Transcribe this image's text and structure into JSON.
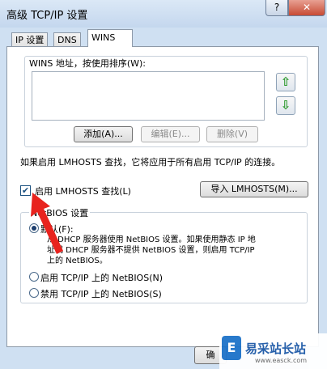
{
  "window": {
    "title": "高级 TCP/IP 设置",
    "help_label": "?",
    "close_label": "✕"
  },
  "tabs": [
    {
      "label": "IP 设置",
      "active": false
    },
    {
      "label": "DNS",
      "active": false
    },
    {
      "label": "WINS",
      "active": true
    }
  ],
  "wins": {
    "group_label": "WINS 地址，按使用排序(W):",
    "addresses": [],
    "up_icon": "green-up-arrow-icon",
    "down_icon": "green-down-arrow-icon",
    "add_label": "添加(A)...",
    "edit_label": "编辑(E)...",
    "delete_label": "删除(V)"
  },
  "lmhosts": {
    "info_text": "如果启用 LMHOSTS 查找，它将应用于所有启用 TCP/IP 的连接。",
    "enable_label": "启用 LMHOSTS 查找(L)",
    "enable_checked": true,
    "import_label": "导入 LMHOSTS(M)..."
  },
  "netbios": {
    "group_label": "NetBIOS 设置",
    "options": [
      {
        "label": "默认(F):",
        "selected": true
      },
      {
        "label": "启用 TCP/IP 上的 NetBIOS(N)",
        "selected": false
      },
      {
        "label": "禁用 TCP/IP 上的 NetBIOS(S)",
        "selected": false
      }
    ],
    "default_desc": [
      "从 DHCP 服务器使用 NetBIOS 设置。如果使用静态 IP 地",
      "址或 DHCP 服务器不提供 NetBIOS 设置，则启用 TCP/IP",
      "上的 NetBIOS。"
    ]
  },
  "footer": {
    "ok_label": "确"
  },
  "watermark": {
    "logo_icon": "site-logo-icon",
    "logo_glyph": "E",
    "text": "易采站长站",
    "url": "www.easck.com"
  },
  "colors": {
    "annotation_arrow": "#e8231e"
  }
}
